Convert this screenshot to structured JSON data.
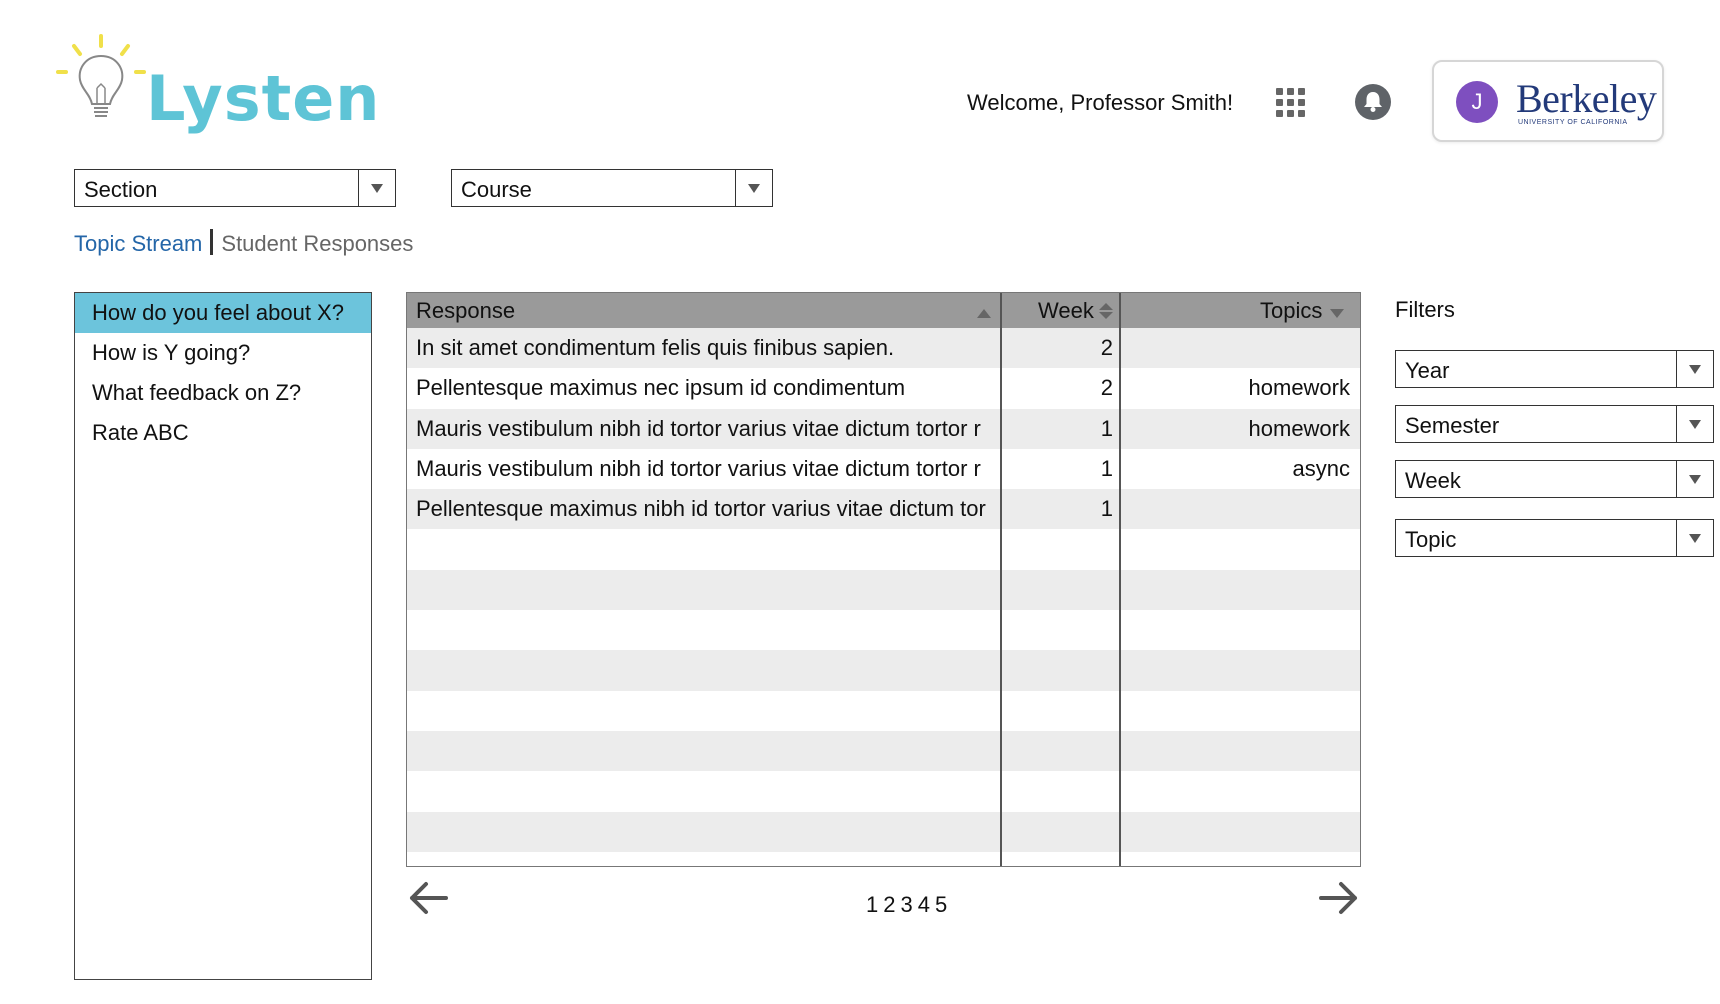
{
  "app": {
    "name": "Lysten"
  },
  "header": {
    "welcome_text": "Welcome, Professor Smith!",
    "avatar_initial": "J",
    "institution_name": "Berkeley",
    "institution_sub": "UNIVERSITY OF CALIFORNIA"
  },
  "selects": {
    "section": "Section",
    "course": "Course"
  },
  "tabs": {
    "active": "Topic Stream",
    "inactive": "Student Responses"
  },
  "questions": [
    {
      "label": "How do you feel about X?",
      "active": true
    },
    {
      "label": "How is Y going?",
      "active": false
    },
    {
      "label": "What feedback on Z?",
      "active": false
    },
    {
      "label": "Rate ABC",
      "active": false
    }
  ],
  "table": {
    "columns": {
      "response": "Response",
      "week": "Week",
      "topics": "Topics"
    },
    "rows": [
      {
        "response": "In sit amet condimentum felis quis finibus sapien.",
        "week": "2",
        "topics": ""
      },
      {
        "response": "Pellentesque maximus nec ipsum id condimentum",
        "week": "2",
        "topics": "homework"
      },
      {
        "response": "Mauris vestibulum nibh id tortor varius vitae dictum tortor r",
        "week": "1",
        "topics": "homework"
      },
      {
        "response": "Mauris vestibulum nibh id tortor varius vitae dictum tortor r",
        "week": "1",
        "topics": "async"
      },
      {
        "response": "Pellentesque maximus nibh id tortor varius vitae dictum tor",
        "week": "1",
        "topics": ""
      },
      {
        "response": "",
        "week": "",
        "topics": ""
      },
      {
        "response": "",
        "week": "",
        "topics": ""
      },
      {
        "response": "",
        "week": "",
        "topics": ""
      },
      {
        "response": "",
        "week": "",
        "topics": ""
      },
      {
        "response": "",
        "week": "",
        "topics": ""
      },
      {
        "response": "",
        "week": "",
        "topics": ""
      },
      {
        "response": "",
        "week": "",
        "topics": ""
      },
      {
        "response": "",
        "week": "",
        "topics": ""
      },
      {
        "response": "",
        "week": "",
        "topics": ""
      }
    ]
  },
  "pagination": {
    "pages": [
      "1",
      "2",
      "3",
      "4",
      "5"
    ]
  },
  "filters": {
    "label": "Filters",
    "year": "Year",
    "semester": "Semester",
    "week": "Week",
    "topic": "Topic"
  },
  "colors": {
    "brand": "#5ec4d6",
    "active_question": "#6cc4dc",
    "link": "#2466a8",
    "table_header": "#9a9a9a",
    "avatar": "#7e4fbf"
  },
  "icons": {
    "logo": "lightbulb-icon",
    "apps": "grid-icon",
    "notifications": "bell-icon",
    "prev": "arrow-left-icon",
    "next": "arrow-right-icon"
  }
}
